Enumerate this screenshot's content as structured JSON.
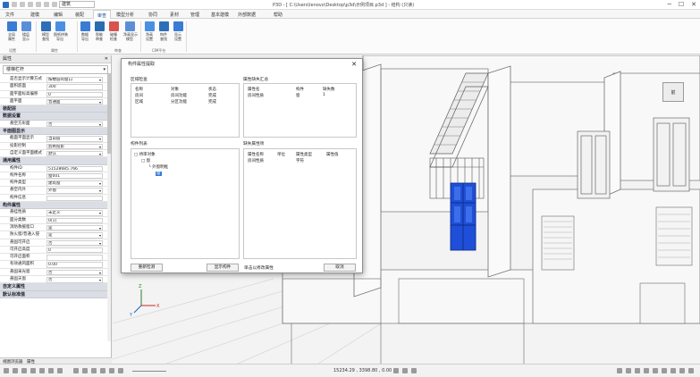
{
  "titlebar": {
    "title": "P3D - [ C:\\Users\\lenovo\\Desktop\\p3d\\示例项目.p3d ] - 结构 (只读)",
    "view_mode": "建筑",
    "minimize": "─",
    "maximize": "☐",
    "close": "✕"
  },
  "menu": {
    "tabs": [
      "文件",
      "建模",
      "编辑",
      "装配",
      "审查",
      "模型分析",
      "协同",
      "素材",
      "管理",
      "基本建模",
      "外部数据",
      "帮助"
    ],
    "active_index": 4
  },
  "ribbon": {
    "buttons": [
      {
        "label": "全局\n属性",
        "icon": "globe-props-icon",
        "color": "#3a7bd5"
      },
      {
        "label": "楼层\n显示",
        "icon": "floor-icon",
        "color": "#5a8fd8"
      },
      {
        "label": "模型\n查找",
        "icon": "model-find-icon",
        "color": "#2d6fb8"
      },
      {
        "label": "图纸拼装\n导出",
        "icon": "drawing-export-icon",
        "color": "#4a90e2"
      },
      {
        "label": "数据\n导出",
        "icon": "data-export-icon",
        "color": "#3a7bd5"
      },
      {
        "label": "智能\n审查",
        "icon": "smart-check-icon",
        "color": "#2b6cb0"
      },
      {
        "label": "碰撞\n检查",
        "icon": "collision-icon",
        "color": "#d9534f"
      },
      {
        "label": "净高显示\n模型",
        "icon": "clearance-icon",
        "color": "#5a8fd8"
      },
      {
        "label": "净高\n设置",
        "icon": "height-icon",
        "color": "#4a90e2"
      },
      {
        "label": "构件\n查找",
        "icon": "component-find-icon",
        "color": "#2d6fb8"
      },
      {
        "label": "显示\n设置",
        "icon": "display-settings-icon",
        "color": "#3a7bd5"
      }
    ],
    "groups": [
      "设置",
      "属性",
      "审查",
      "CIM平台"
    ]
  },
  "properties": {
    "title": "属性",
    "type_value": "楼梯栏杆",
    "rows": [
      {
        "k": "是否显示计算方式",
        "v": "按楼层的窗口",
        "dd": true
      },
      {
        "k": "面积底面",
        "v": "300",
        "dd": false
      },
      {
        "k": "面平面标高偏移",
        "v": "0",
        "dd": false
      },
      {
        "k": "面平面",
        "v": "普通面",
        "dd": true
      },
      {
        "section": "装配层"
      },
      {
        "section": "数据设置"
      },
      {
        "k": "悬空方形面",
        "v": "否",
        "dd": true
      },
      {
        "section": "平面图显示"
      },
      {
        "k": "截面平面显示",
        "v": "当前层",
        "dd": true
      },
      {
        "k": "投影控制",
        "v": "剪断投影",
        "dd": true
      },
      {
        "k": "自定义面平面模式",
        "v": "默认",
        "dd": true
      },
      {
        "section": "通用属性"
      },
      {
        "k": "构件ID",
        "v": "51528685.766",
        "dd": false
      },
      {
        "k": "构件名称",
        "v": "窗001",
        "dd": false
      },
      {
        "k": "构件类型",
        "v": "建筑窗",
        "dd": true
      },
      {
        "k": "悬空内外",
        "v": "外窗",
        "dd": true
      },
      {
        "k": "构件信息",
        "v": "",
        "dd": false
      },
      {
        "section": "构件属性"
      },
      {
        "k": "悬挂性质",
        "v": "未定义",
        "dd": true
      },
      {
        "k": "面分类数",
        "v": "0(1)",
        "dd": false
      },
      {
        "k": "消防救援窗口",
        "v": "是",
        "dd": true
      },
      {
        "k": "防火窗/普通入侵",
        "v": "是",
        "dd": true
      },
      {
        "k": "悬固可开启",
        "v": "否",
        "dd": true
      },
      {
        "k": "可开启高度",
        "v": "0",
        "dd": false
      },
      {
        "k": "可开启面积",
        "v": "",
        "dd": false
      },
      {
        "k": "有效通风面积",
        "v": "0.00",
        "dd": false
      },
      {
        "k": "悬固采光窗",
        "v": "否",
        "dd": true
      },
      {
        "k": "悬固天窗",
        "v": "否",
        "dd": true
      },
      {
        "section": "自定义属性"
      },
      {
        "section": "默认标准值"
      }
    ],
    "bottom_tabs": [
      "视图浏览器",
      "属性"
    ]
  },
  "dialog": {
    "title": "构件属性提取",
    "left_top_label": "区域检查",
    "left_top_headers": [
      "名称",
      "对象",
      "状态"
    ],
    "left_top_rows": [
      [
        "房间",
        "房间功能",
        "完成"
      ],
      [
        "区域",
        "分区功能",
        "完成"
      ]
    ],
    "right_top_label": "属性缺失汇总",
    "right_top_headers": [
      "属性名",
      "构件",
      "缺失数"
    ],
    "right_top_rows": [
      [
        "房间性质",
        "窗",
        "1"
      ]
    ],
    "left_bottom_label": "构件列表",
    "tree_root": "□ 待审对象",
    "tree_child": "□ 窗",
    "tree_grandchild": "└ 外窗明框",
    "tree_leaf": "窗",
    "right_bottom_label": "缺失属性项",
    "right_bottom_headers": [
      "属性名称",
      "单位",
      "属性类型",
      "属性值"
    ],
    "right_bottom_rows": [
      [
        "房间性质",
        "",
        "字符",
        ""
      ]
    ],
    "bottom_hint": "单击以修改属性",
    "buttons": {
      "recheck": "重新检测",
      "show_component": "显示构件",
      "cancel": "取消"
    }
  },
  "statusbar": {
    "coords": "15234.29 , 3398.80 , 0.00"
  },
  "viewcube_label": "前"
}
